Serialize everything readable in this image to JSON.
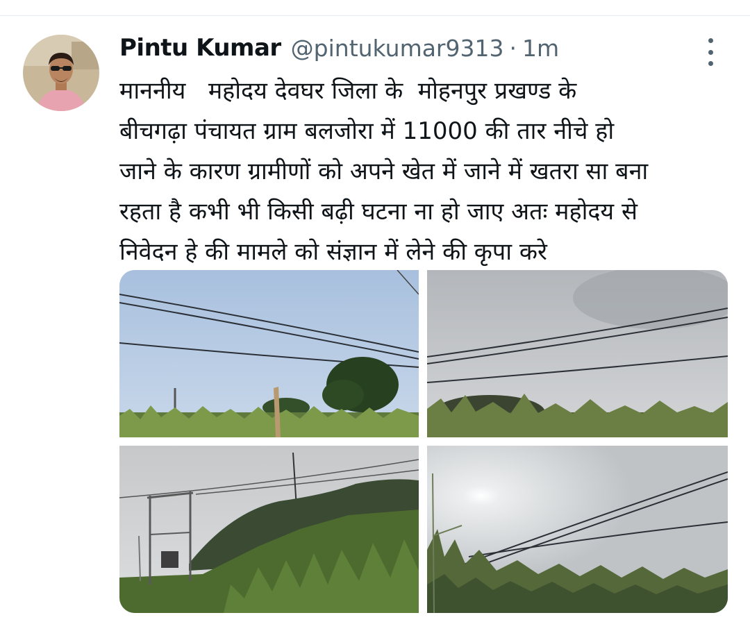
{
  "tweet": {
    "author": {
      "display_name": "Pintu Kumar",
      "handle": "@pintukumar9313",
      "avatar_icon": "profile-photo"
    },
    "separator": "·",
    "timestamp": "1m",
    "more_icon": "more-vertical-icon",
    "text": "माननीय   महोदय देवघर जिला के  मोहनपुर प्रखण्ड के\nबीचगढ़ा पंचायत ग्राम बलजोरा में 11000 की तार नीचे हो\nजाने के कारण ग्रामीणों को अपने खेत में जाने में खतरा सा बना\nरहता है कभी भी किसी बढ़ी घटना ना हो जाए अतः महोदय से\nनिवेदन हे की मामले को संज्ञान में लेने की कृपा करे",
    "media": [
      {
        "subject": "power-lines-over-corn-field-with-tree"
      },
      {
        "subject": "power-lines-over-corn-field-overcast"
      },
      {
        "subject": "transformer-pole-by-corn-field"
      },
      {
        "subject": "power-lines-sun-corn-field"
      }
    ]
  },
  "colors": {
    "text_primary": "#0f1419",
    "text_secondary": "#536471",
    "divider": "#e6ecf0"
  }
}
